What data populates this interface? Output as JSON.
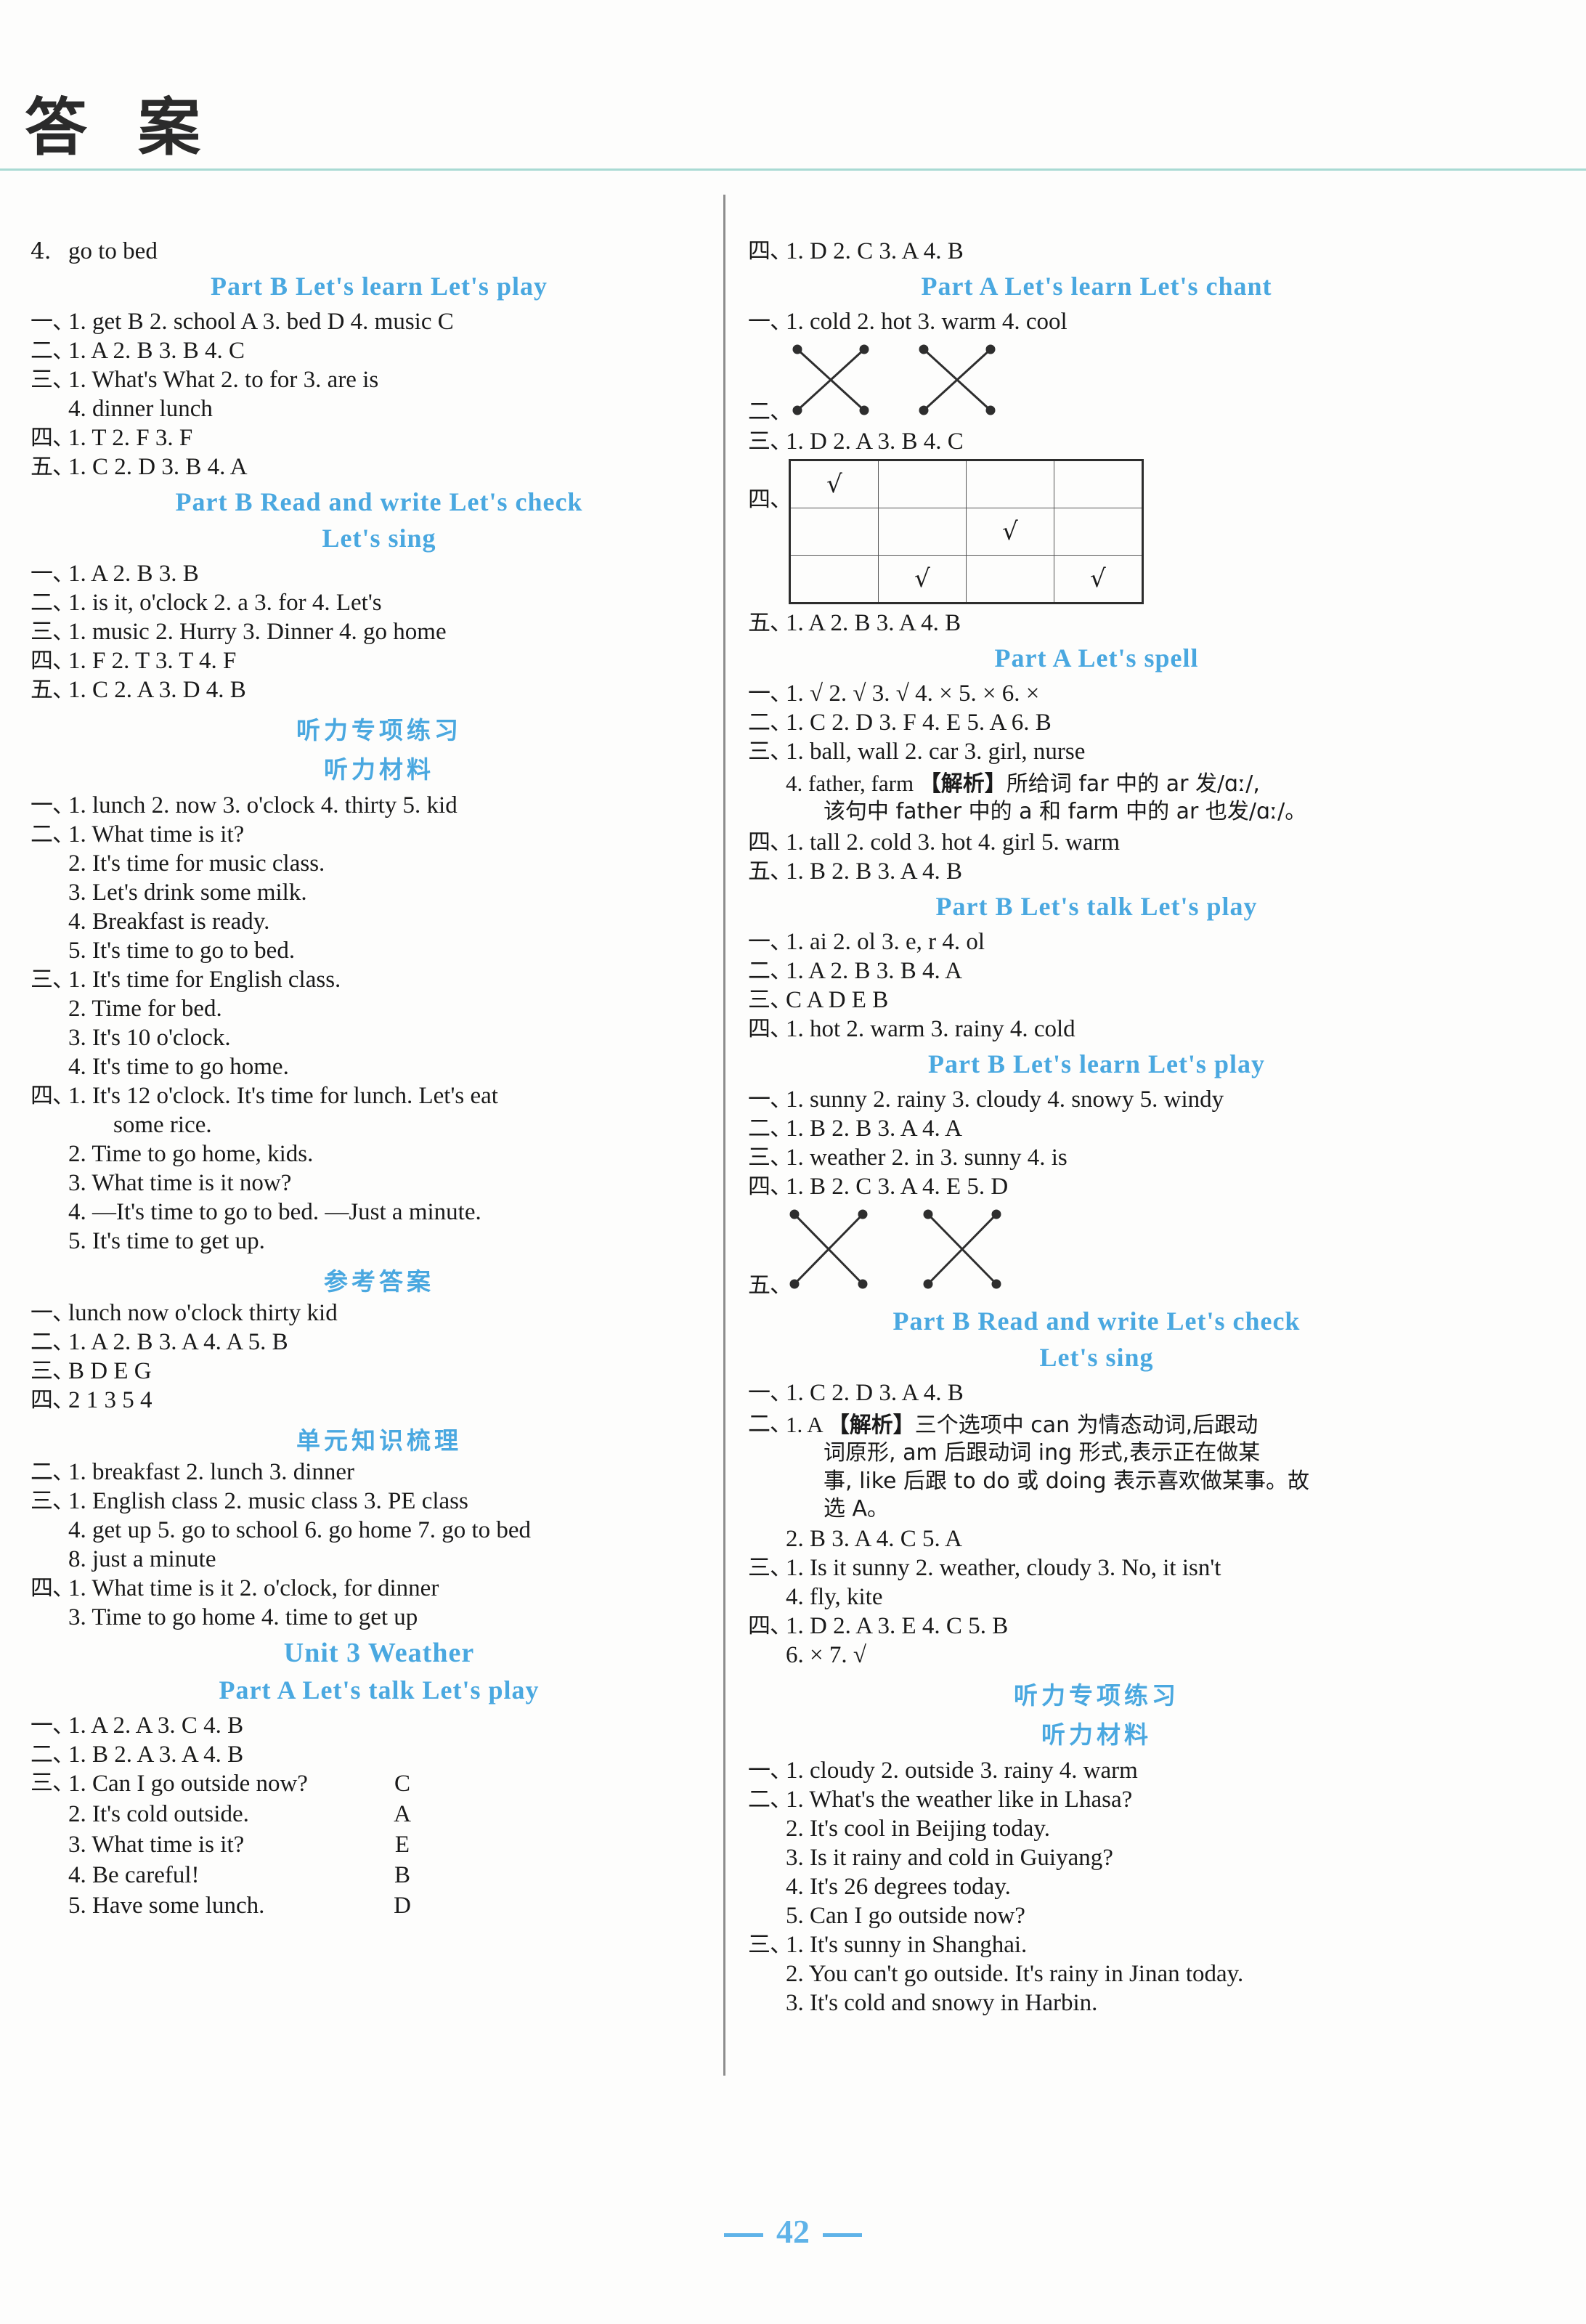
{
  "page": {
    "title": "答 案",
    "number": "42",
    "accent_color": "#4aa8e0",
    "rule_color": "#a9dad3"
  },
  "left_column": {
    "cont_line": {
      "num": "4.",
      "text": "go to bed"
    },
    "head_partB_learn_play": "Part B   Let's learn   Let's play",
    "s1": {
      "l1": {
        "num": "一、",
        "text": "1. get   B    2. school   A    3. bed   D    4. music    C"
      },
      "l2": {
        "num": "二、",
        "text": "1. A   2. B   3. B   4. C"
      },
      "l3": {
        "num": "三、",
        "text": "1. What's   What   2. to   for   3. are   is"
      },
      "l3b": {
        "num": "",
        "text": "4. dinner   lunch"
      },
      "l4": {
        "num": "四、",
        "text": "1. T   2. F   3. F"
      },
      "l5": {
        "num": "五、",
        "text": "1. C   2. D   3. B   4. A"
      }
    },
    "head_partB_readwrite_check": "Part B   Read and write   Let's check",
    "head_lets_sing": "Let's sing",
    "s2": {
      "l1": {
        "num": "一、",
        "text": "1. A   2. B   3. B"
      },
      "l2": {
        "num": "二、",
        "text": "1. is it, o'clock   2. a   3. for   4. Let's"
      },
      "l3": {
        "num": "三、",
        "text": "1. music   2. Hurry   3. Dinner   4. go home"
      },
      "l4": {
        "num": "四、",
        "text": "1. F   2. T   3. T   4. F"
      },
      "l5": {
        "num": "五、",
        "text": "1. C   2. A   3. D   4. B"
      }
    },
    "head_listening_practice": "听力专项练习",
    "head_listening_material": "听力材料",
    "s3": {
      "l1": {
        "num": "一、",
        "text": "1. lunch   2. now   3. o'clock   4. thirty   5. kid"
      },
      "l2_head": {
        "num": "二、",
        "text": "1. What time is it?"
      },
      "l2_items": [
        "2. It's time for music class.",
        "3. Let's drink some milk.",
        "4. Breakfast is ready.",
        "5. It's time to go to bed."
      ],
      "l3_head": {
        "num": "三、",
        "text": "1. It's time for English class."
      },
      "l3_items": [
        "2. Time for bed.",
        "3. It's 10 o'clock.",
        "4. It's time to go home."
      ],
      "l4_head": {
        "num": "四、",
        "text": "1. It's 12 o'clock. It's time for lunch. Let's eat"
      },
      "l4_head_wrap": "some rice.",
      "l4_items": [
        "2. Time to go home, kids.",
        "3. What time is it now?",
        "4. —It's time to go to bed. —Just a minute.",
        "5. It's time to get up."
      ]
    },
    "head_reference_answers": "参考答案",
    "s4": {
      "l1": {
        "num": "一、",
        "text": "lunch   now   o'clock   thirty   kid"
      },
      "l2": {
        "num": "二、",
        "text": "1. A   2. B   3. A   4. A   5. B"
      },
      "l3": {
        "num": "三、",
        "text": "B   D   E   G"
      },
      "l4": {
        "num": "四、",
        "text": "2   1   3   5   4"
      }
    },
    "head_unit_knowledge": "单元知识梳理",
    "s5": {
      "l2": {
        "num": "二、",
        "text": "1. breakfast   2. lunch   3. dinner"
      },
      "l3": {
        "num": "三、",
        "text": "1. English class   2. music class   3. PE class"
      },
      "l3b": {
        "num": "",
        "text": "4. get up   5. go to school   6. go home   7. go to bed"
      },
      "l3c": {
        "num": "",
        "text": "8. just a minute"
      },
      "l4": {
        "num": "四、",
        "text": "1. What time is it   2. o'clock, for dinner"
      },
      "l4b": {
        "num": "",
        "text": "3. Time to go home   4. time to get up"
      }
    },
    "head_unit3": "Unit 3   Weather",
    "head_partA_talk_play": "Part A   Let's talk   Let's play",
    "s6": {
      "l1": {
        "num": "一、",
        "text": "1. A   2. A   3. C   4. B"
      },
      "l2": {
        "num": "二、",
        "text": "1. B   2. A   3. A   4. B"
      },
      "l3_num": "三、",
      "matches": [
        {
          "q": "1. Can I go outside now?",
          "a": "C"
        },
        {
          "q": "2. It's cold outside.",
          "a": "A"
        },
        {
          "q": "3. What time is it?",
          "a": "E"
        },
        {
          "q": "4. Be careful!",
          "a": "B"
        },
        {
          "q": "5. Have some lunch.",
          "a": "D"
        }
      ]
    }
  },
  "right_column": {
    "cont_line": {
      "num": "四、",
      "text": "1. D   2. C   3. A   4. B"
    },
    "head_partA_learn_chant": "Part A   Let's learn   Let's chant",
    "s1": {
      "l1": {
        "num": "一、",
        "text": "1. cold   2. hot   3. warm   4. cool"
      },
      "l2_num": "二、",
      "l3": {
        "num": "三、",
        "text": "1. D   2. A   3. B   4. C"
      },
      "l4_num": "四、",
      "grid": {
        "rows": 3,
        "cols": 4,
        "check_glyph": "√",
        "cells": [
          [
            "√",
            "",
            "",
            ""
          ],
          [
            "",
            "",
            "√",
            ""
          ],
          [
            "",
            "√",
            "",
            "√"
          ]
        ]
      },
      "l5": {
        "num": "五、",
        "text": "1. A   2. B   3. A   4. B"
      }
    },
    "head_partA_spell": "Part A   Let's spell",
    "s2": {
      "l1": {
        "num": "一、",
        "text": "1. √   2. √   3. √   4. ×   5. ×   6. ×"
      },
      "l2": {
        "num": "二、",
        "text": "1. C   2. D   3. F   4. E   5. A   6. B"
      },
      "l3": {
        "num": "三、",
        "text": "1. ball, wall   2. car   3. girl, nurse"
      },
      "l3b_prefix": "4. father, farm  ",
      "l3b_jiexi": "【解析】",
      "l3b_cn": "所给词 far 中的 ar 发/ɑː/,",
      "l3b_cn2": "该句中 father 中的 a 和 farm 中的 ar 也发/ɑː/。",
      "l4": {
        "num": "四、",
        "text": "1. tall   2. cold   3. hot   4. girl   5. warm"
      },
      "l5": {
        "num": "五、",
        "text": "1. B   2. B   3. A   4. B"
      }
    },
    "head_partB_talk_play": "Part B   Let's talk   Let's play",
    "s3": {
      "l1": {
        "num": "一、",
        "text": "1. ai   2. ol   3. e, r   4. ol"
      },
      "l2": {
        "num": "二、",
        "text": "1. A   2. B   3. B   4. A"
      },
      "l3": {
        "num": "三、",
        "text": "C   A   D   E   B"
      },
      "l4": {
        "num": "四、",
        "text": "1. hot   2. warm   3. rainy   4. cold"
      }
    },
    "head_partB_learn_play": "Part B   Let's learn   Let's play",
    "s4": {
      "l1": {
        "num": "一、",
        "text": "1. sunny   2. rainy   3. cloudy   4. snowy   5. windy"
      },
      "l2": {
        "num": "二、",
        "text": "1. B   2. B   3. A   4. A"
      },
      "l3": {
        "num": "三、",
        "text": "1. weather   2. in   3. sunny   4. is"
      },
      "l4": {
        "num": "四、",
        "text": "1. B   2. C   3. A   4. E   5. D"
      },
      "l5_num": "五、"
    },
    "head_partB_readwrite_check": "Part B   Read and write   Let's check",
    "head_lets_sing": "Let's sing",
    "s5": {
      "l1": {
        "num": "一、",
        "text": "1. C   2. D   3. A   4. B"
      },
      "l2_prefix": "1. A  ",
      "l2_num": "二、",
      "l2_jiexi": "【解析】",
      "l2_cn_1": "三个选项中 can 为情态动词,后跟动",
      "l2_cn_2": "词原形, am 后跟动词 ing 形式,表示正在做某",
      "l2_cn_3": "事, like 后跟 to do 或 doing 表示喜欢做某事。故",
      "l2_cn_4": "选 A。",
      "l2b": "2. B   3. A   4. C   5. A",
      "l3": {
        "num": "三、",
        "text": "1. Is it sunny   2. weather, cloudy   3. No, it isn't"
      },
      "l3b": {
        "num": "",
        "text": "4. fly, kite"
      },
      "l4": {
        "num": "四、",
        "text": "1. D   2. A   3. E   4. C   5. B"
      },
      "l4b": {
        "num": "",
        "text": "6. ×   7. √"
      }
    },
    "head_listening_practice": "听力专项练习",
    "head_listening_material": "听力材料",
    "s6": {
      "l1": {
        "num": "一、",
        "text": "1. cloudy   2. outside   3. rainy   4. warm"
      },
      "l2_head": {
        "num": "二、",
        "text": "1. What's the weather like in Lhasa?"
      },
      "l2_items": [
        "2. It's cool in Beijing today.",
        "3. Is it rainy and cold in Guiyang?",
        "4. It's 26 degrees today.",
        "5. Can I go outside now?"
      ],
      "l3_head": {
        "num": "三、",
        "text": "1. It's sunny in Shanghai."
      },
      "l3_items": [
        "2. You can't go outside. It's rainy in Jinan today.",
        "3. It's cold and snowy in Harbin."
      ]
    }
  }
}
